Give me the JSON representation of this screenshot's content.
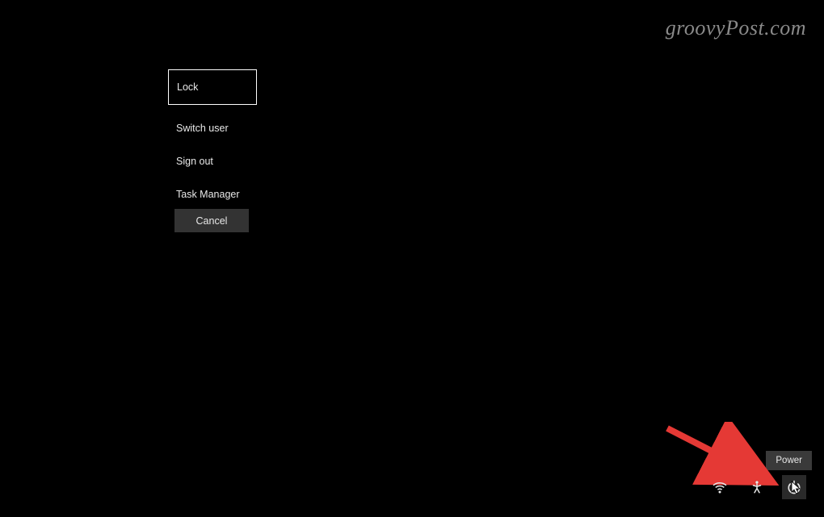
{
  "watermark": "groovyPost.com",
  "menu": {
    "items": [
      {
        "label": "Lock",
        "selected": true
      },
      {
        "label": "Switch user",
        "selected": false
      },
      {
        "label": "Sign out",
        "selected": false
      },
      {
        "label": "Task Manager",
        "selected": false
      }
    ],
    "cancel_label": "Cancel"
  },
  "tooltip": {
    "power": "Power"
  },
  "icons": {
    "wifi": "wifi-icon",
    "accessibility": "accessibility-icon",
    "power": "power-icon"
  },
  "annotation": {
    "arrow_color": "#e53935"
  }
}
